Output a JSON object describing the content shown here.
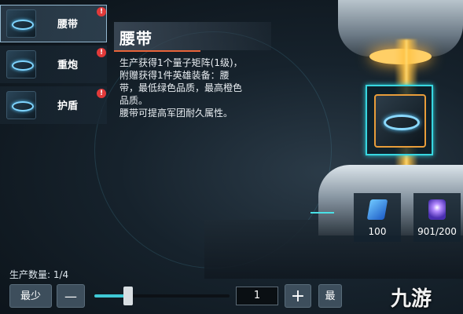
{
  "sidebar": {
    "items": [
      {
        "label": "腰带",
        "alert": "!"
      },
      {
        "label": "重炮",
        "alert": "!"
      },
      {
        "label": "护盾",
        "alert": "!"
      }
    ]
  },
  "detail": {
    "title": "腰带",
    "mini_caption": "",
    "description": "生产获得1个量子矩阵(1级)，\n附赠获得1件英雄装备：腰\n带，最低绿色品质，最高橙色\n品质。\n腰带可提高军团耐久属性。"
  },
  "resources": [
    {
      "icon": "blue-crystal-icon",
      "value": "100"
    },
    {
      "icon": "purple-cube-icon",
      "value": "901/200"
    }
  ],
  "production": {
    "qty_label": "生产数量: 1/4",
    "min_label": "最少",
    "minus_label": "—",
    "quantity": "1",
    "plus_label": "+",
    "max_label": "最",
    "slider_fraction": 0.25
  },
  "watermark": "九游",
  "colors": {
    "accent": "#3fc9d6",
    "alert": "#e23a3a",
    "frame": "#e89d3a"
  }
}
